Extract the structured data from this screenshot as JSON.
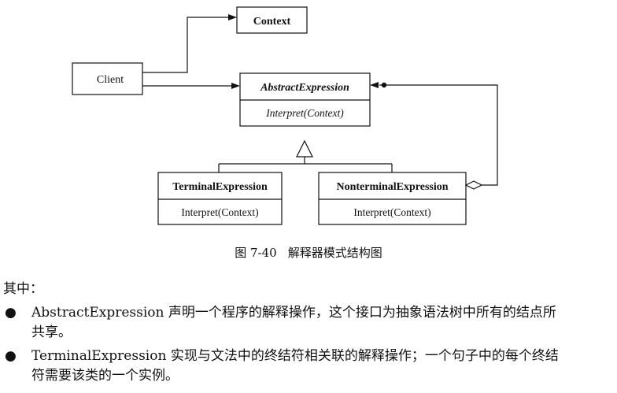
{
  "diagram": {
    "context": {
      "name": "Context"
    },
    "client": {
      "name": "Client"
    },
    "abstract_expression": {
      "name": "AbstractExpression",
      "operation": "Interpret(Context)"
    },
    "terminal_expression": {
      "name": "TerminalExpression",
      "operation": "Interpret(Context)"
    },
    "nonterminal_expression": {
      "name": "NonterminalExpression",
      "operation": "Interpret(Context)"
    }
  },
  "caption": {
    "number": "图 7-40",
    "title": "解释器模式结构图"
  },
  "text": {
    "intro": "其中：",
    "bullets": [
      {
        "symbol": "●",
        "line1": "AbstractExpression 声明一个程序的解释操作，这个接口为抽象语法树中所有的结点所",
        "line2": "共享。"
      },
      {
        "symbol": "●",
        "line1": "TerminalExpression 实现与文法中的终结符相关联的解释操作；一个句子中的每个终结",
        "line2": "符需要该类的一个实例。"
      }
    ]
  }
}
